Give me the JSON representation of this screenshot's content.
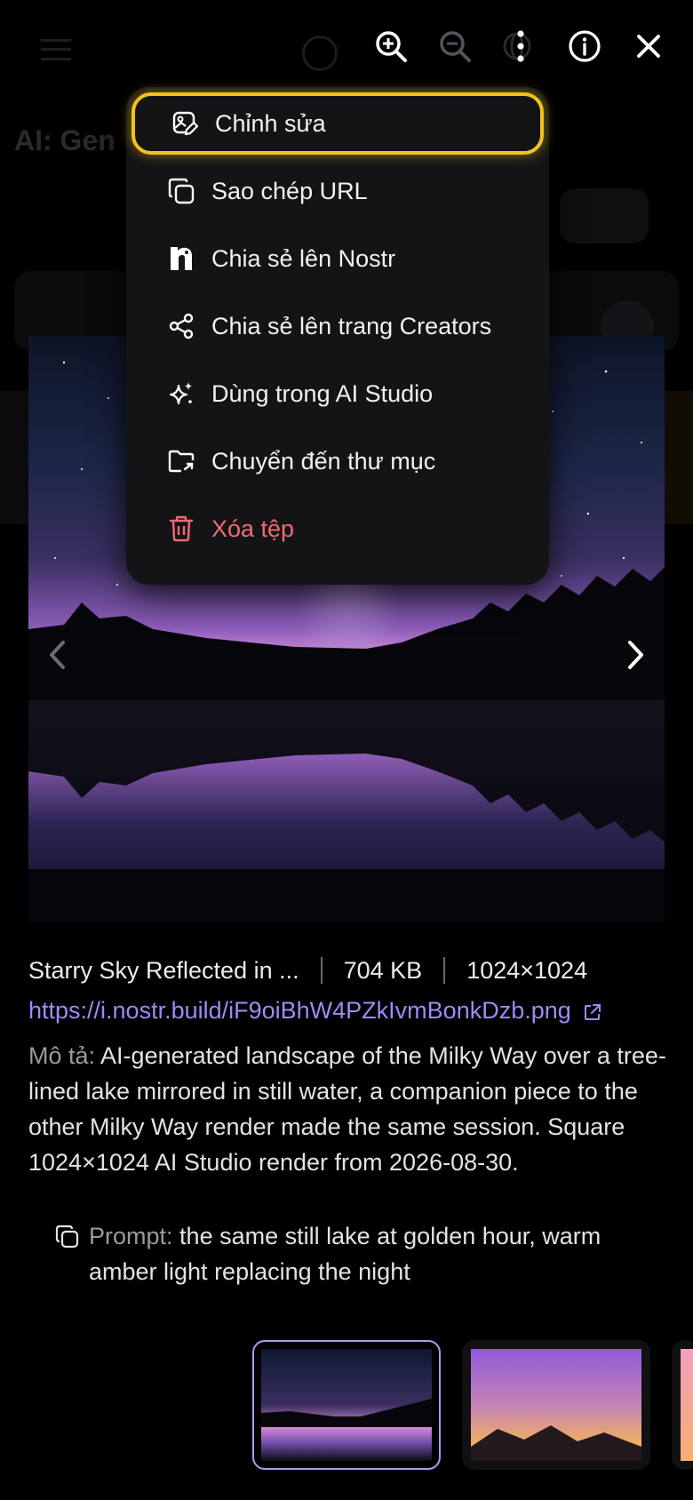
{
  "background": {
    "page_title": "AI: Gen"
  },
  "toolbar": {
    "zoom_in": "zoom-in-icon",
    "zoom_out": "zoom-out-icon",
    "more": "more-vertical-icon",
    "info": "info-icon",
    "close": "close-icon"
  },
  "menu": {
    "items": [
      {
        "label": "Chỉnh sửa",
        "icon": "edit-image-icon"
      },
      {
        "label": "Sao chép URL",
        "icon": "copy-icon"
      },
      {
        "label": "Chia sẻ lên Nostr",
        "icon": "nostr-icon"
      },
      {
        "label": "Chia sẻ lên trang Creators",
        "icon": "share-icon"
      },
      {
        "label": "Dùng trong AI Studio",
        "icon": "sparkles-icon"
      },
      {
        "label": "Chuyển đến thư mục",
        "icon": "move-folder-icon"
      },
      {
        "label": "Xóa tệp",
        "icon": "trash-icon"
      }
    ]
  },
  "file": {
    "name": "Starry Sky Reflected in ...",
    "size": "704 KB",
    "dimensions": "1024×1024",
    "url": "https://i.nostr.build/iF9oiBhW4PZkIvmBonkDzb.png",
    "description_label": "Mô tả:",
    "description": "AI-generated landscape of the Milky Way over a tree-lined lake mirrored in still water, a companion piece to the other Milky Way render made the same session. Square 1024×1024 AI Studio render from 2026-08-30.",
    "prompt_label": "Prompt:",
    "prompt": "the same still lake at golden hour, warm amber light replacing the night"
  },
  "colors": {
    "accent": "#9b8cf5",
    "highlight": "#f3c21a",
    "danger": "#f16a74"
  }
}
